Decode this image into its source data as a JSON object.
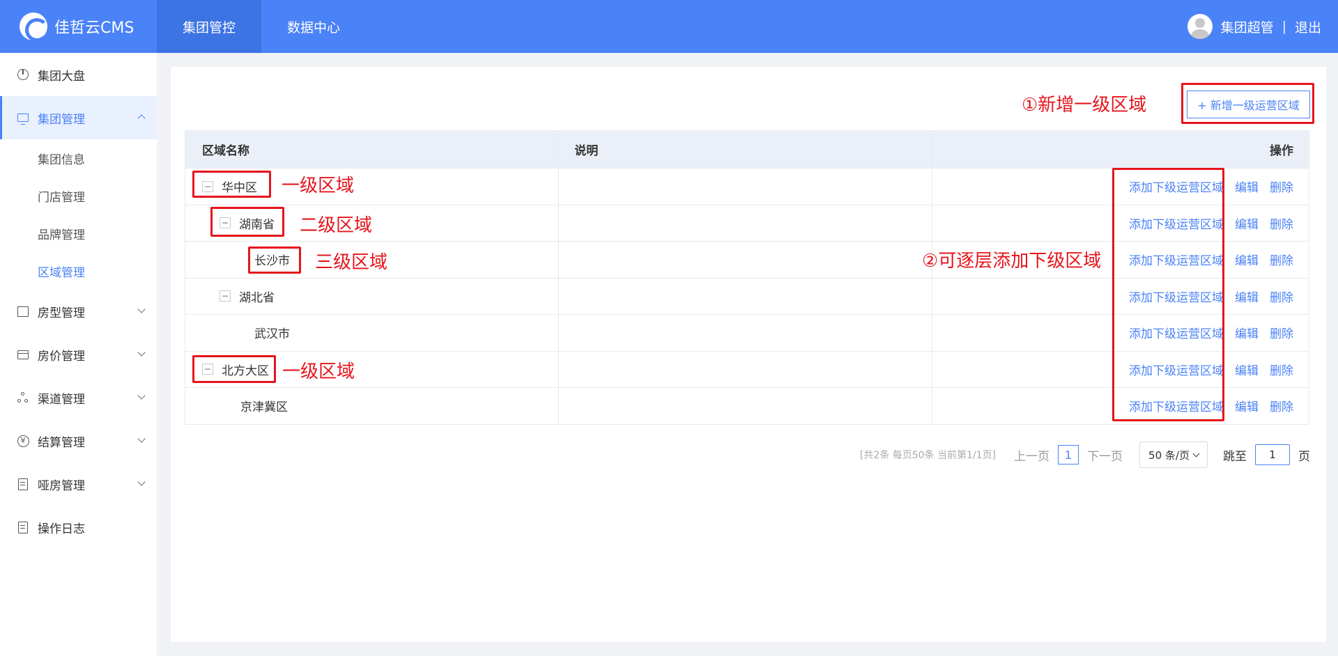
{
  "header": {
    "brand": "佳哲云CMS",
    "tabs": [
      "集团管控",
      "数据中心"
    ],
    "user_name": "集团超管",
    "separator": "|",
    "logout": "退出"
  },
  "sidebar": {
    "items": [
      {
        "label": "集团大盘"
      },
      {
        "label": "集团管理",
        "sub": [
          "集团信息",
          "门店管理",
          "品牌管理",
          "区域管理"
        ]
      },
      {
        "label": "房型管理"
      },
      {
        "label": "房价管理"
      },
      {
        "label": "渠道管理"
      },
      {
        "label": "结算管理"
      },
      {
        "label": "哑房管理"
      },
      {
        "label": "操作日志"
      }
    ]
  },
  "toolbar": {
    "add_button": "+ 新增一级运营区域"
  },
  "table": {
    "headers": [
      "区域名称",
      "说明",
      "操作"
    ],
    "rows": [
      {
        "name": "华中区",
        "level": 1
      },
      {
        "name": "湖南省",
        "level": 2
      },
      {
        "name": "长沙市",
        "level": 3
      },
      {
        "name": "湖北省",
        "level": 2
      },
      {
        "name": "武汉市",
        "level": 3
      },
      {
        "name": "北方大区",
        "level": 1
      },
      {
        "name": "京津冀区",
        "level": 2
      }
    ],
    "ops": {
      "add_child": "添加下级运营区域",
      "edit": "编辑",
      "delete": "删除"
    },
    "toggle_symbol": "−"
  },
  "pagination": {
    "info": "[共2条 每页50条 当前第1/1页]",
    "prev": "上一页",
    "current": "1",
    "next": "下一页",
    "page_size": "50 条/页",
    "jump_label": "跳至",
    "jump_value": "1",
    "page_unit": "页"
  },
  "annotations": {
    "add_top": "①新增一级区域",
    "level1_a": "一级区域",
    "level2": "二级区域",
    "level3": "三级区域",
    "add_sub": "②可逐层添加下级区域",
    "level1_b": "一级区域",
    "color": "#e6141c"
  },
  "colors": {
    "primary": "#4a82f7",
    "header_active": "#3d74e4",
    "annotation": "#e6141c"
  }
}
